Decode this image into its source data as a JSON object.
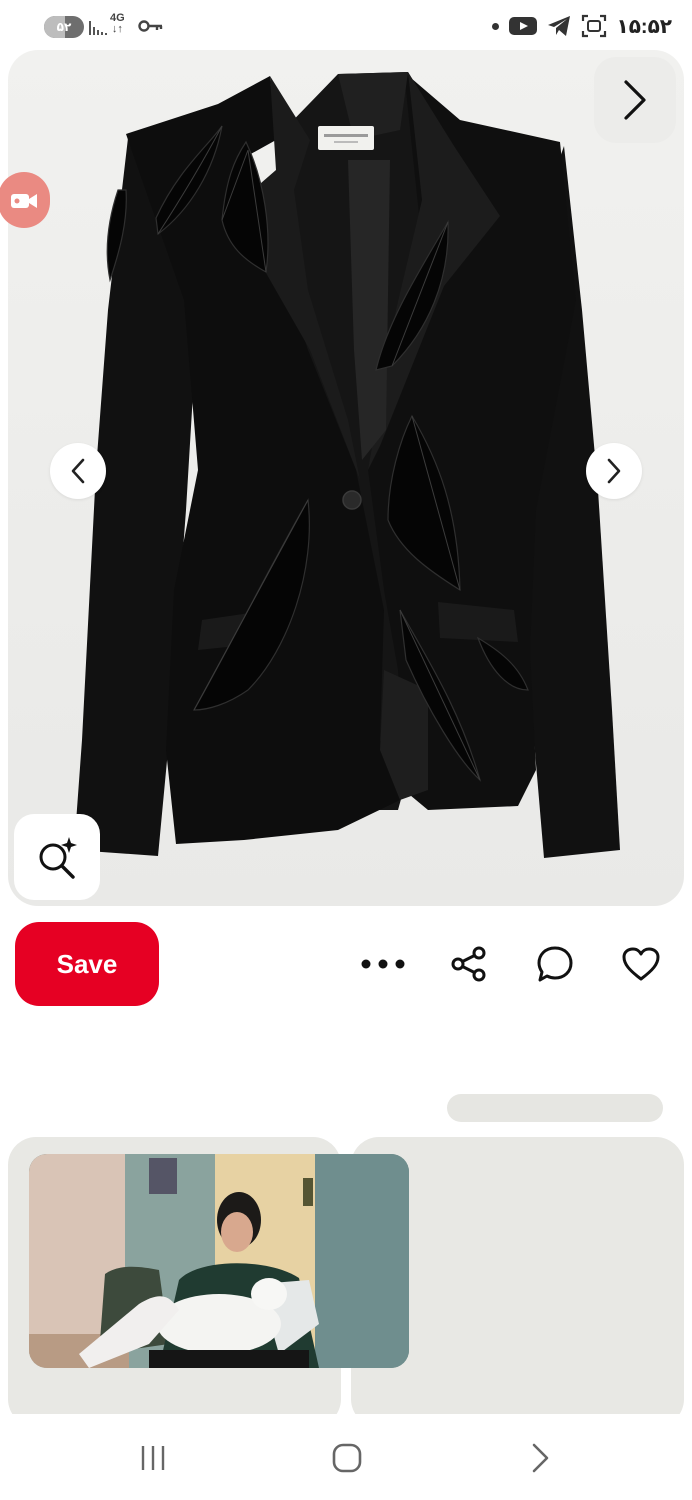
{
  "status_bar": {
    "battery_level": "۵۲",
    "battery_fraction": 0.52,
    "network_type": "4G",
    "time": "۱۵:۵۲"
  },
  "hero": {
    "image_subject": "black tailored blazer with beaded feather embellishments",
    "close_icon": "chevron-right-icon",
    "prev_icon": "chevron-left-icon",
    "next_icon": "chevron-right-icon",
    "visual_search_icon": "sparkle-search-icon"
  },
  "actions": {
    "save_label": "Save",
    "more_icon": "more-icon",
    "share_icon": "share-icon",
    "comment_icon": "comment-icon",
    "like_icon": "heart-icon"
  },
  "colors": {
    "save_button": "#e60023",
    "skeleton": "#e8e8e4",
    "record_badge": "#ea8a82"
  },
  "nav_bar": {
    "recent_icon": "recent-apps-icon",
    "home_icon": "home-icon",
    "back_icon": "back-icon"
  }
}
